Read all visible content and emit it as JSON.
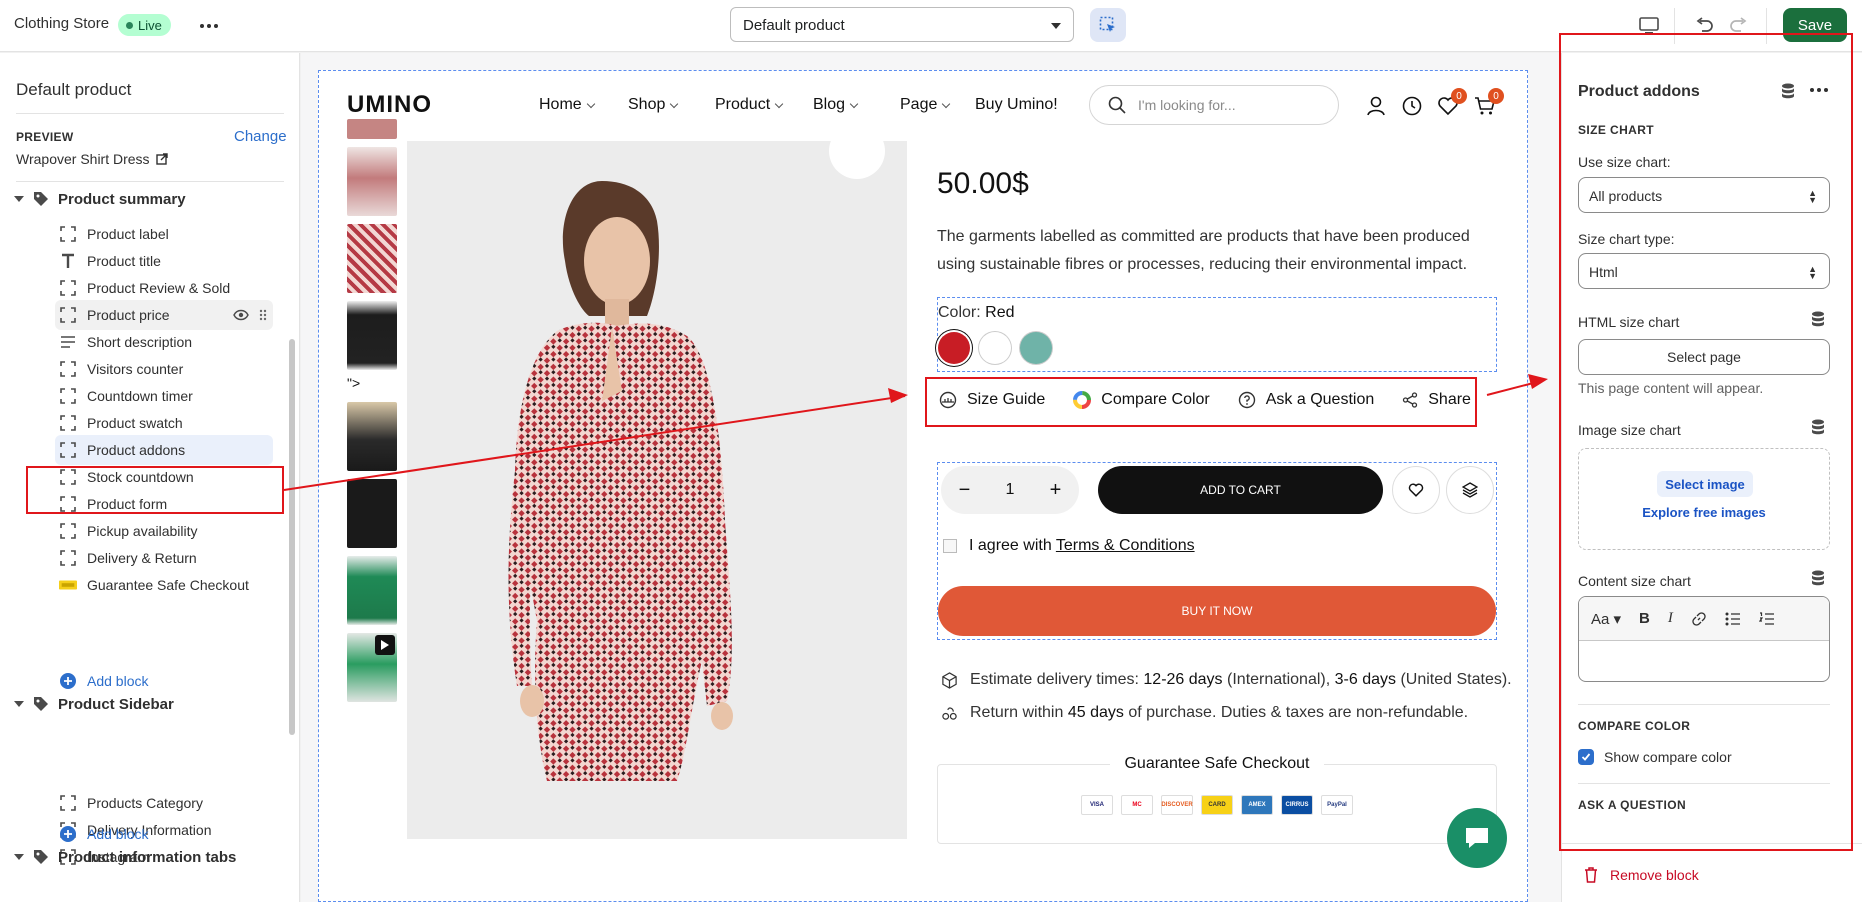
{
  "topbar": {
    "store_name": "Clothing Store",
    "status": "Live",
    "template": "Default product",
    "save": "Save"
  },
  "sidebar": {
    "title": "Default product",
    "preview_label": "PREVIEW",
    "change": "Change",
    "preview_product": "Wrapover Shirt Dress",
    "sections": [
      {
        "title": "Product summary",
        "items": [
          "Product label",
          "Product title",
          "Product Review & Sold",
          "Product price",
          "Short description",
          "Visitors counter",
          "Countdown timer",
          "Product swatch",
          "Product addons",
          "Stock countdown",
          "Product form",
          "Pickup availability",
          "Delivery & Return",
          "Guarantee Safe Checkout"
        ],
        "add_block": "Add block"
      },
      {
        "title": "Product Sidebar",
        "items": [
          "Products Category",
          "Delivery Information",
          "Instagram"
        ],
        "add_block": "Add block"
      },
      {
        "title": "Product information tabs"
      }
    ],
    "selected_item": "Product addons"
  },
  "store": {
    "logo": "UMINO",
    "nav": [
      "Home",
      "Shop",
      "Product",
      "Blog",
      "Page",
      "Buy Umino!"
    ],
    "search_placeholder": "I'm looking for...",
    "wishlist_count": "0",
    "cart_count": "0",
    "stray_text": "\">",
    "price": "50.00$",
    "description": "The garments labelled as committed are products that have been produced using sustainable fibres or processes, reducing their environmental impact.",
    "color_label": "Color:",
    "color_value": "Red",
    "swatch_colors": [
      "#c81d25",
      "#ffffff",
      "#6fb3a8"
    ],
    "addons": [
      "Size Guide",
      "Compare Color",
      "Ask a Question",
      "Share"
    ],
    "quantity": "1",
    "add_to_cart": "ADD TO CART",
    "agree_prefix": "I agree with",
    "agree_link": "Terms & Conditions",
    "buy_now": "BUY IT NOW",
    "delivery": {
      "prefix": "Estimate delivery times:",
      "intl_days": "12-26 days",
      "intl_label": "(International),",
      "us_days": "3-6 days",
      "us_label": "(United States)."
    },
    "returns": {
      "prefix": "Return within",
      "days": "45 days",
      "suffix": "of purchase. Duties & taxes are non-refundable."
    },
    "guarantee_title": "Guarantee Safe Checkout",
    "payment_cards": [
      "VISA",
      "MC",
      "DISCOVER",
      "CARD",
      "AMEX",
      "CIRRUS",
      "PayPal"
    ]
  },
  "panel": {
    "title": "Product addons",
    "size_chart_heading": "SIZE CHART",
    "use_size_chart_label": "Use size chart:",
    "use_size_chart_value": "All products",
    "size_chart_type_label": "Size chart type:",
    "size_chart_type_value": "Html",
    "html_size_chart_label": "HTML size chart",
    "select_page": "Select page",
    "page_note": "This page content will appear.",
    "image_size_chart_label": "Image size chart",
    "select_image": "Select image",
    "explore_images": "Explore free images",
    "content_size_chart_label": "Content size chart",
    "compare_color_heading": "COMPARE COLOR",
    "show_compare_color": "Show compare color",
    "ask_question_heading": "ASK A QUESTION",
    "remove_block": "Remove block"
  },
  "colors": {
    "accent_green": "#1b6f3d",
    "annotation_red": "#e0161b",
    "buy_now": "#e05837",
    "link_blue": "#2c6ecb"
  }
}
